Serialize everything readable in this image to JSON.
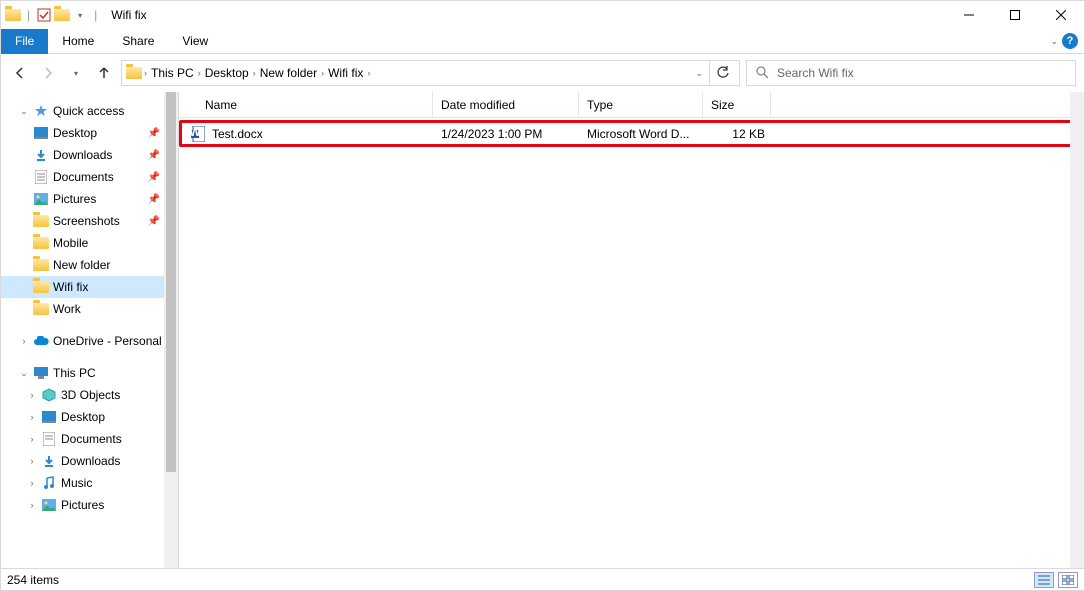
{
  "window": {
    "title": "Wifi fix"
  },
  "ribbon": {
    "file": "File",
    "tabs": [
      "Home",
      "Share",
      "View"
    ]
  },
  "breadcrumbs": [
    "This PC",
    "Desktop",
    "New folder",
    "Wifi fix"
  ],
  "search": {
    "placeholder": "Search Wifi fix"
  },
  "columns": {
    "name": "Name",
    "date": "Date modified",
    "type": "Type",
    "size": "Size"
  },
  "files": [
    {
      "name": "Test.docx",
      "date": "1/24/2023 1:00 PM",
      "type": "Microsoft Word D...",
      "size": "12 KB"
    }
  ],
  "tree": {
    "quick_access": "Quick access",
    "desktop": "Desktop",
    "downloads": "Downloads",
    "documents": "Documents",
    "pictures": "Pictures",
    "screenshots": "Screenshots",
    "mobile": "Mobile",
    "new_folder": "New folder",
    "wifi_fix": "Wifi fix",
    "work": "Work",
    "onedrive": "OneDrive - Personal",
    "this_pc": "This PC",
    "objects3d": "3D Objects",
    "desktop2": "Desktop",
    "documents2": "Documents",
    "downloads2": "Downloads",
    "music": "Music",
    "pictures2": "Pictures"
  },
  "status": {
    "items": "254 items"
  }
}
